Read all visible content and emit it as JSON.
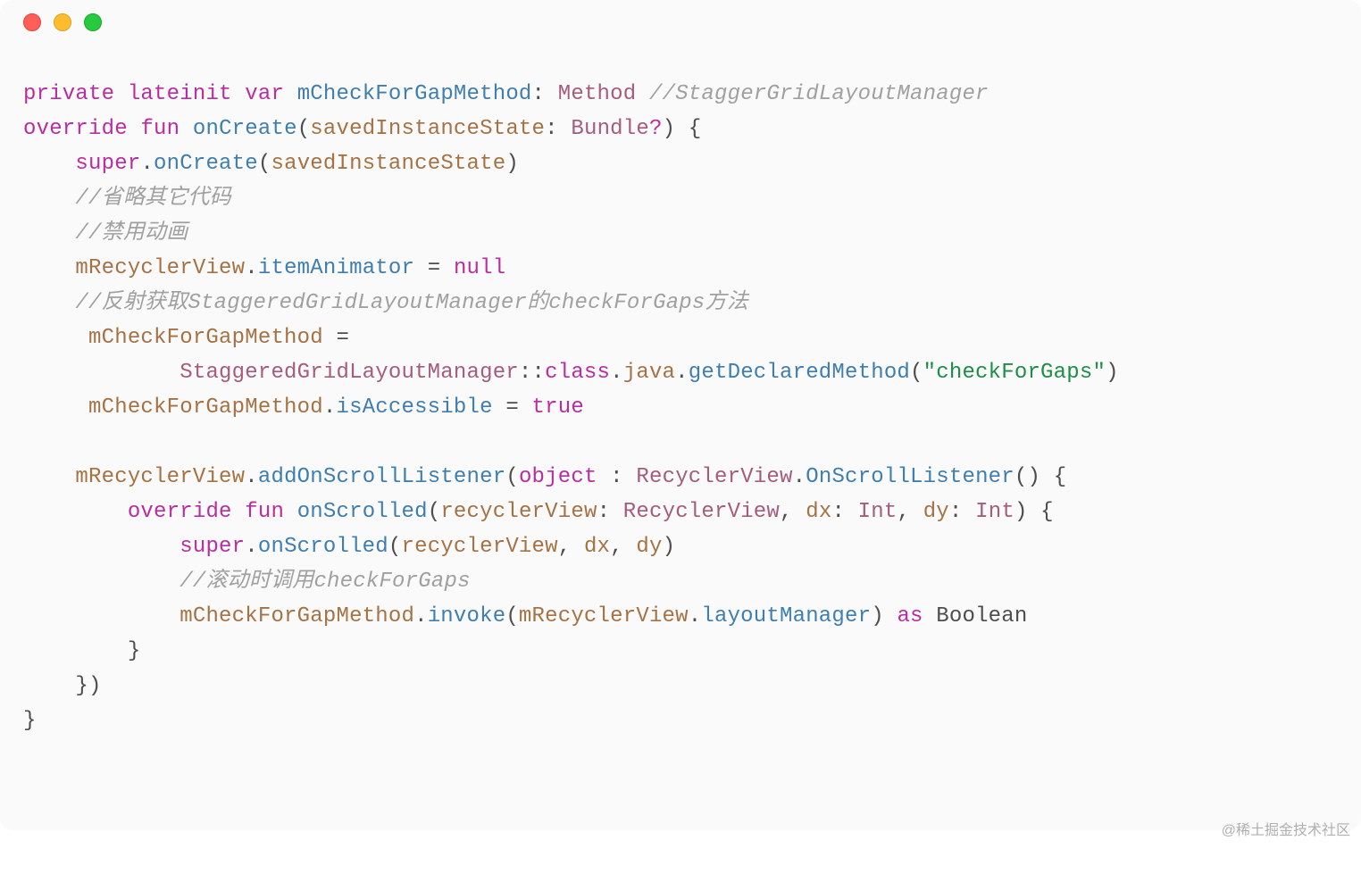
{
  "code": {
    "t1_private": "private",
    "t1_lateinit": "lateinit",
    "t1_var": "var",
    "t1_name": "mCheckForGapMethod",
    "t1_colon": ":",
    "t1_type": "Method",
    "t1_cmt": "//StaggerGridLayoutManager",
    "t2_override": "override",
    "t2_fun": "fun",
    "t2_name": "onCreate",
    "t2_lp": "(",
    "t2_param": "savedInstanceState",
    "t2_colon": ":",
    "t2_type": "Bundle",
    "t2_q": "?",
    "t2_rp": ")",
    "t2_brace": "{",
    "t3_super": "super",
    "t3_dot": ".",
    "t3_call": "onCreate",
    "t3_lp": "(",
    "t3_arg": "savedInstanceState",
    "t3_rp": ")",
    "t4_cmt": "//省略其它代码",
    "t5_cmt": "//禁用动画",
    "t6_obj": "mRecyclerView",
    "t6_dot": ".",
    "t6_prop": "itemAnimator",
    "t6_eq": "=",
    "t6_null": "null",
    "t7_cmt": "//反射获取StaggeredGridLayoutManager的checkForGaps方法",
    "t8_lhs": "mCheckForGapMethod",
    "t8_eq": "=",
    "t9_cls": "StaggeredGridLayoutManager",
    "t9_cc": "::",
    "t9_class": "class",
    "t9_dot1": ".",
    "t9_java": "java",
    "t9_dot2": ".",
    "t9_get": "getDeclaredMethod",
    "t9_lp": "(",
    "t9_str": "\"checkForGaps\"",
    "t9_rp": ")",
    "t10_lhs": "mCheckForGapMethod",
    "t10_dot": ".",
    "t10_prop": "isAccessible",
    "t10_eq": "=",
    "t10_true": "true",
    "t12_obj": "mRecyclerView",
    "t12_dot": ".",
    "t12_mth": "addOnScrollListener",
    "t12_lp": "(",
    "t12_object": "object",
    "t12_colon": ":",
    "t12_rv": "RecyclerView",
    "t12_dot2": ".",
    "t12_osl": "OnScrollListener",
    "t12_paren": "()",
    "t12_brace": "{",
    "t13_override": "override",
    "t13_fun": "fun",
    "t13_name": "onScrolled",
    "t13_lp": "(",
    "t13_p1": "recyclerView",
    "t13_c1": ":",
    "t13_t1": "RecyclerView",
    "t13_cm1": ",",
    "t13_p2": "dx",
    "t13_c2": ":",
    "t13_t2": "Int",
    "t13_cm2": ",",
    "t13_p3": "dy",
    "t13_c3": ":",
    "t13_t3": "Int",
    "t13_rp": ")",
    "t13_brace": "{",
    "t14_super": "super",
    "t14_dot": ".",
    "t14_call": "onScrolled",
    "t14_lp": "(",
    "t14_a1": "recyclerView",
    "t14_cm1": ",",
    "t14_a2": "dx",
    "t14_cm2": ",",
    "t14_a3": "dy",
    "t14_rp": ")",
    "t15_cmt": "//滚动时调用checkForGaps",
    "t16_obj": "mCheckForGapMethod",
    "t16_dot": ".",
    "t16_mth": "invoke",
    "t16_lp": "(",
    "t16_a1": "mRecyclerView",
    "t16_dot2": ".",
    "t16_a2": "layoutManager",
    "t16_rp": ")",
    "t16_as": "as",
    "t16_bool": "Boolean",
    "t17_rb": "}",
    "t18_rb": "})",
    "t19_rb": "}"
  },
  "watermark": "@稀土掘金技术社区"
}
